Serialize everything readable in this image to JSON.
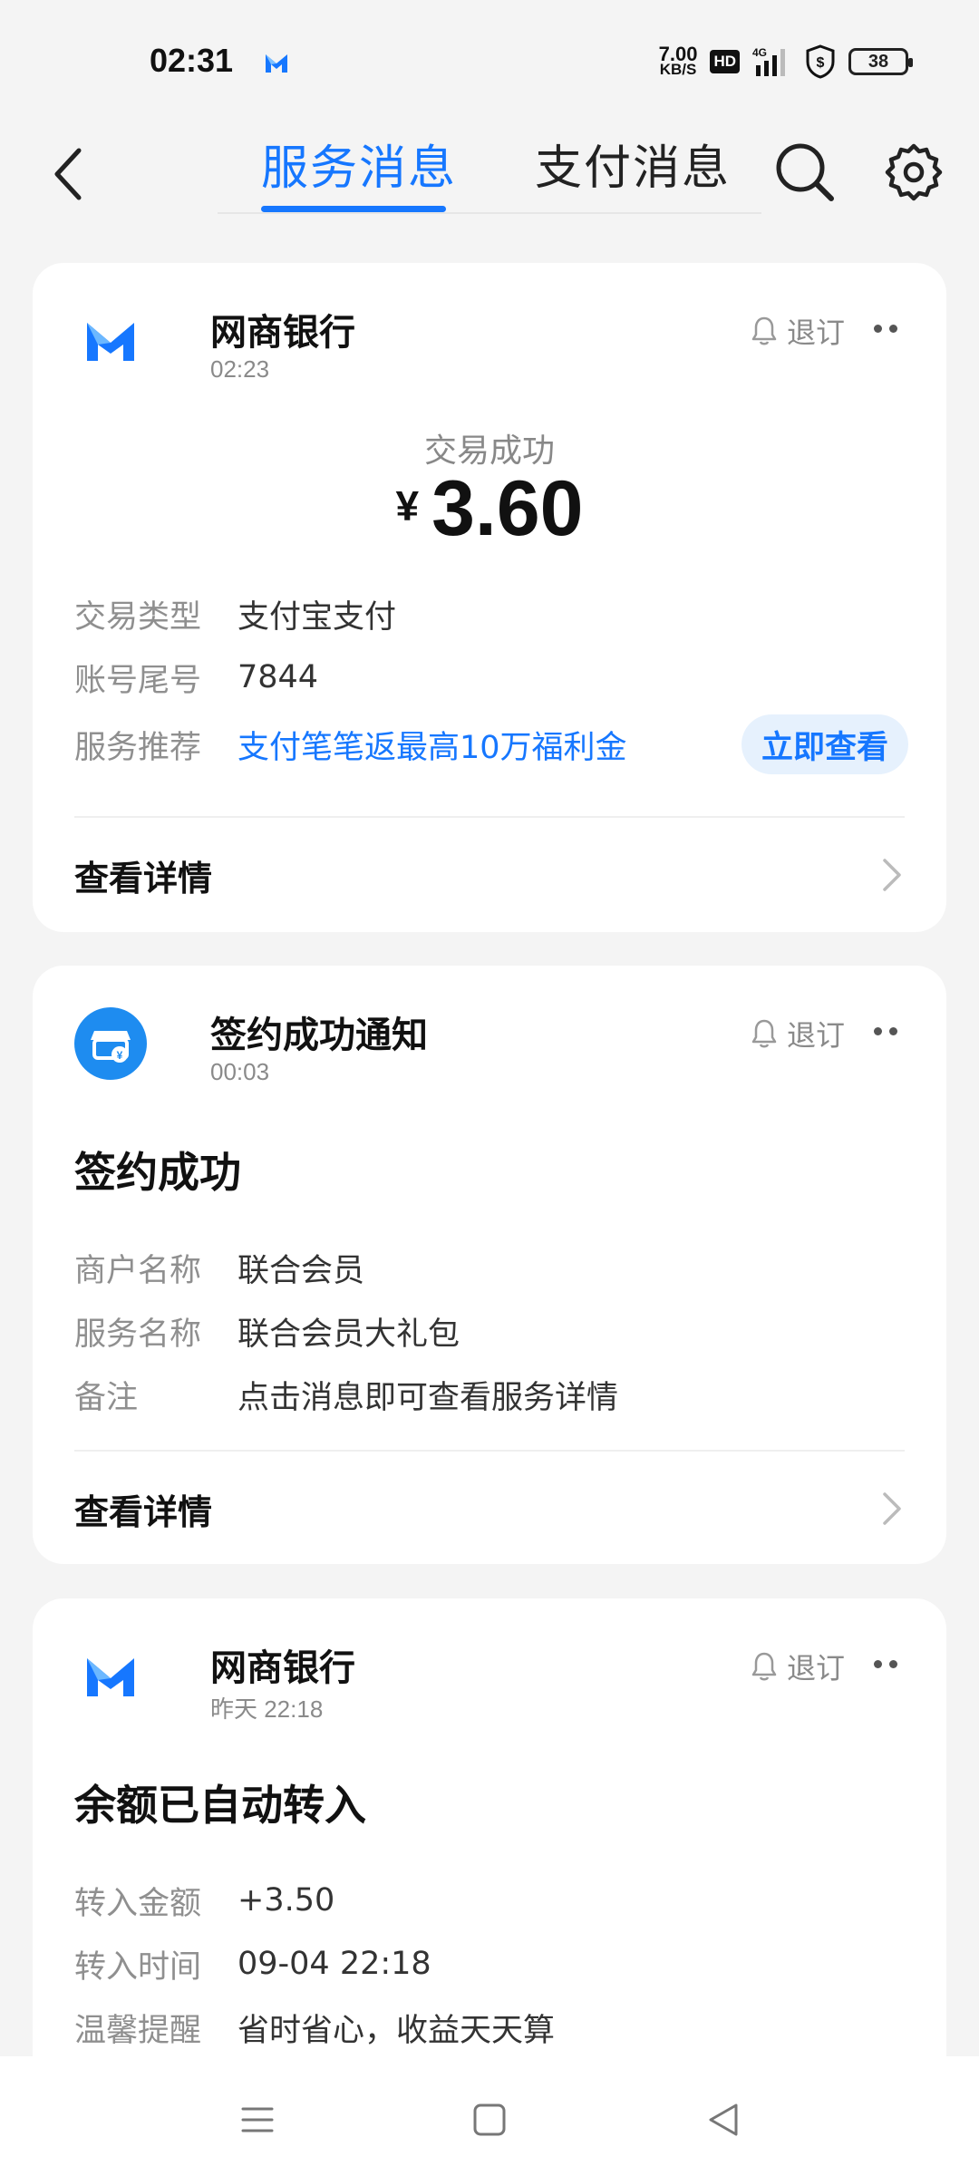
{
  "status_bar": {
    "time": "02:31",
    "net_speed_value": "7.00",
    "net_speed_unit": "KB/S",
    "hd_label": "HD",
    "network_label": "4G",
    "battery_level": "38"
  },
  "header": {
    "tabs": [
      {
        "label": "服务消息",
        "active": true
      },
      {
        "label": "支付消息",
        "active": false
      }
    ],
    "accent_color": "#1677ff"
  },
  "cards": [
    {
      "sender": "网商银行",
      "time": "02:23",
      "unsubscribe_label": "退订",
      "status": "交易成功",
      "currency_symbol": "¥",
      "amount": "3.60",
      "rows": [
        {
          "key": "交易类型",
          "value": "支付宝支付"
        },
        {
          "key": "账号尾号",
          "value": "7844"
        },
        {
          "key": "服务推荐",
          "value": "支付笔笔返最高10万福利金"
        }
      ],
      "promo_button": "立即查看",
      "detail_label": "查看详情"
    },
    {
      "sender": "签约成功通知",
      "time": "00:03",
      "unsubscribe_label": "退订",
      "title": "签约成功",
      "rows": [
        {
          "key": "商户名称",
          "value": "联合会员"
        },
        {
          "key": "服务名称",
          "value": "联合会员大礼包"
        },
        {
          "key": "备注",
          "value": "点击消息即可查看服务详情"
        }
      ],
      "detail_label": "查看详情"
    },
    {
      "sender": "网商银行",
      "time": "昨天 22:18",
      "unsubscribe_label": "退订",
      "title": "余额已自动转入",
      "rows": [
        {
          "key": "转入金额",
          "value": "+3.50"
        },
        {
          "key": "转入时间",
          "value": "09-04 22:18"
        },
        {
          "key": "温馨提醒",
          "value": "省时省心，收益天天算"
        }
      ]
    }
  ]
}
